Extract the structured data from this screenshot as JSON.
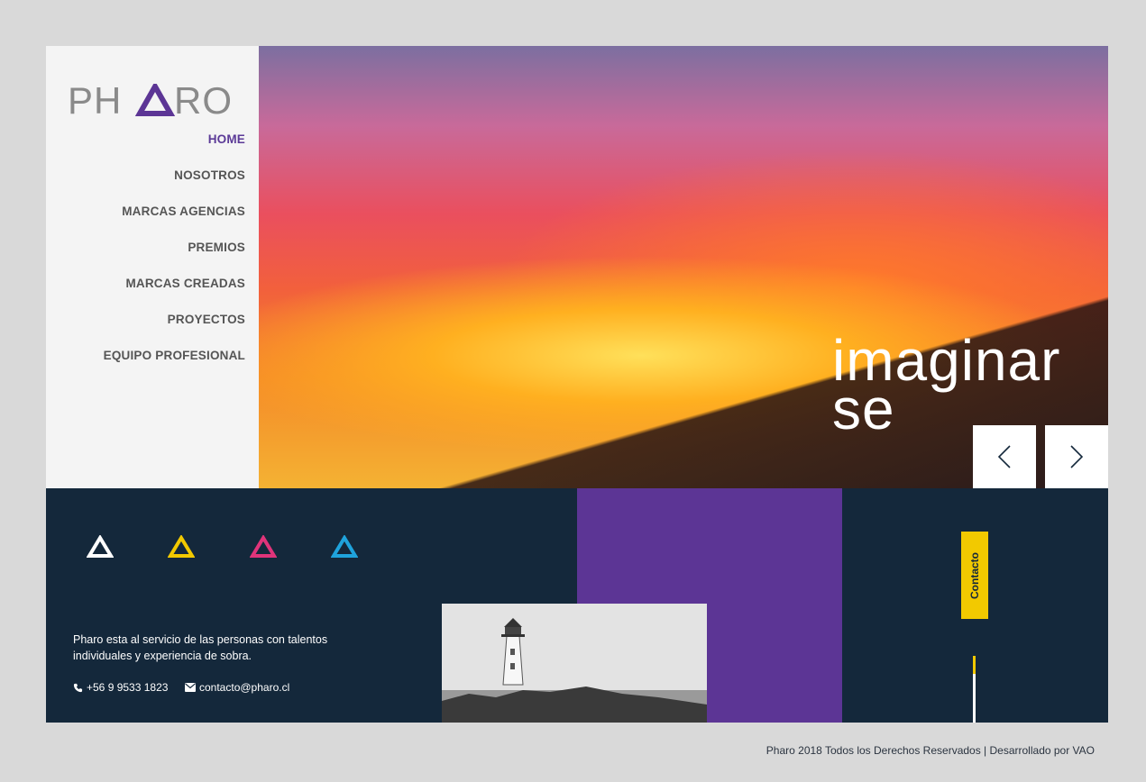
{
  "brand": {
    "name": "PHARO",
    "accent": "#5c3595",
    "logo_color": "#8a8a8a"
  },
  "nav": {
    "items": [
      {
        "label": "HOME",
        "active": true
      },
      {
        "label": "NOSOTROS",
        "active": false
      },
      {
        "label": "MARCAS AGENCIAS",
        "active": false
      },
      {
        "label": "PREMIOS",
        "active": false
      },
      {
        "label": "MARCAS CREADAS",
        "active": false
      },
      {
        "label": "PROYECTOS",
        "active": false
      },
      {
        "label": "EQUIPO PROFESIONAL",
        "active": false
      }
    ]
  },
  "hero": {
    "line1": "imaginar",
    "line2": "se",
    "prev_icon": "chevron-left-icon",
    "next_icon": "chevron-right-icon"
  },
  "footer": {
    "triangle_colors": [
      "#ffffff",
      "#f2c900",
      "#e0347a",
      "#1fa3dc"
    ],
    "about": "Pharo esta al servicio de las personas con talentos individuales y experiencia de sobra.",
    "phone": "+56 9 9533 1823",
    "email": "contacto@pharo.cl",
    "contact_tab": "Contacto",
    "copyright": "Pharo 2018 Todos los Derechos Reservados | Desarrollado por VAO"
  }
}
